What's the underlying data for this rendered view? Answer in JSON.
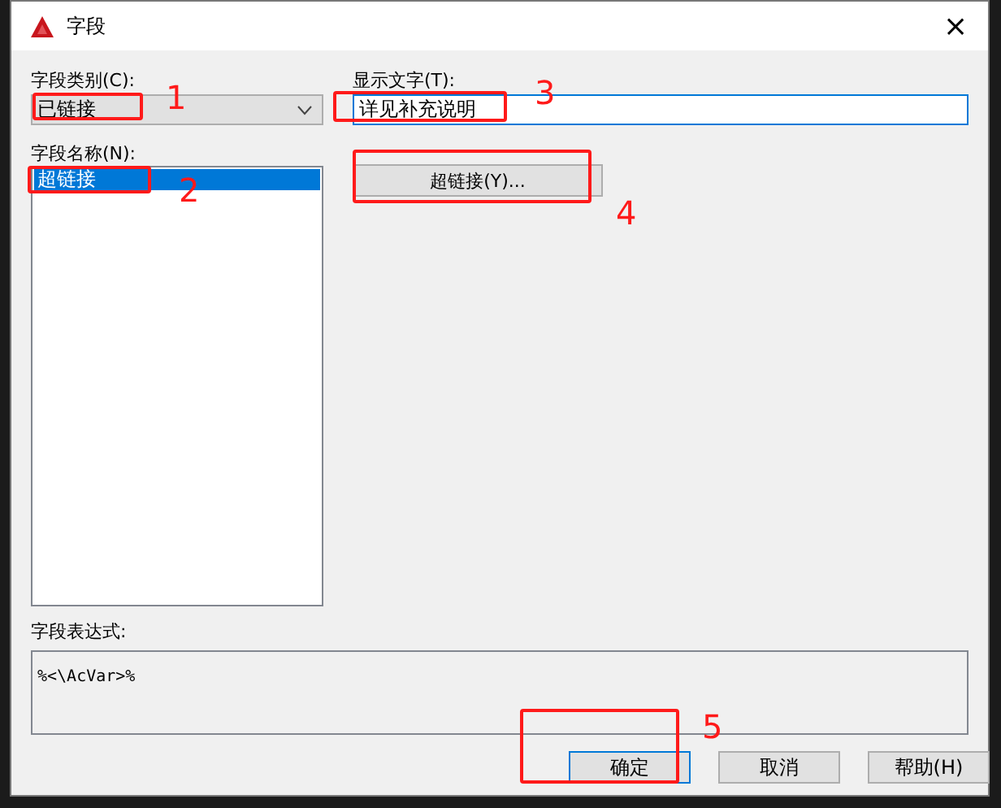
{
  "window": {
    "title": "字段",
    "close": "×"
  },
  "category": {
    "label": "字段类别(C):",
    "value": "已链接"
  },
  "names": {
    "label": "字段名称(N):",
    "items": [
      {
        "text": "超链接",
        "selected": true
      }
    ]
  },
  "display": {
    "label": "显示文字(T):",
    "value": "详见补充说明"
  },
  "hyperlink_button": "超链接(Y)...",
  "expression": {
    "label": "字段表达式:",
    "value": "%<\\AcVar>%"
  },
  "buttons": [
    {
      "label": "确定",
      "default": true
    },
    {
      "label": "取消",
      "default": false
    },
    {
      "label": "帮助(H)",
      "default": false
    }
  ],
  "annotations": [
    "1",
    "2",
    "3",
    "4",
    "5"
  ]
}
